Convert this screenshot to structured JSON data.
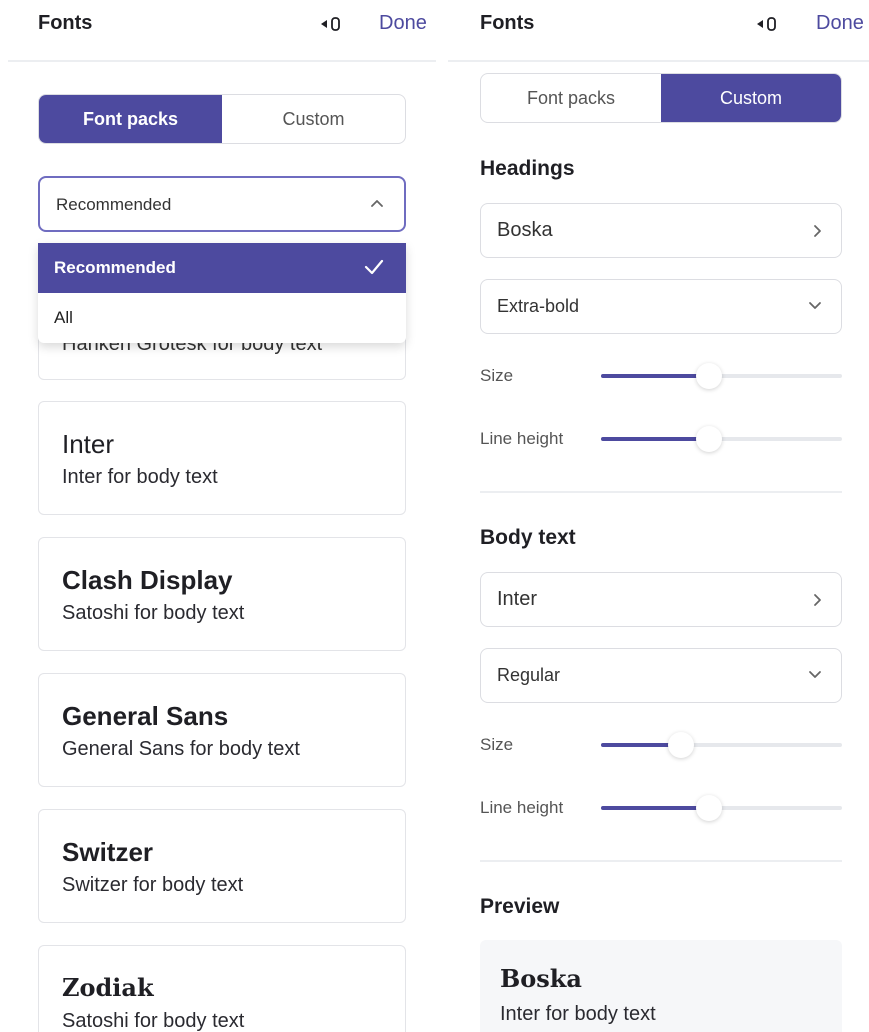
{
  "left_panel": {
    "header": {
      "title": "Fonts",
      "done_label": "Done"
    },
    "tabs": [
      {
        "label": "Font packs",
        "active": true
      },
      {
        "label": "Custom",
        "active": false
      }
    ],
    "filter": {
      "value": "Recommended",
      "options": [
        {
          "label": "Recommended",
          "selected": true
        },
        {
          "label": "All",
          "selected": false
        }
      ]
    },
    "font_packs": [
      {
        "name": "",
        "description": "Hanken Grotesk for body text"
      },
      {
        "name": "Inter",
        "description": "Inter for body text"
      },
      {
        "name": "Clash Display",
        "description": "Satoshi for body text"
      },
      {
        "name": "General Sans",
        "description": "General Sans for body text"
      },
      {
        "name": "Switzer",
        "description": "Switzer for body text"
      },
      {
        "name": "Zodiak",
        "description": "Satoshi for body text"
      }
    ]
  },
  "right_panel": {
    "header": {
      "title": "Fonts",
      "done_label": "Done"
    },
    "tabs": [
      {
        "label": "Font packs",
        "active": false
      },
      {
        "label": "Custom",
        "active": true
      }
    ],
    "headings": {
      "title": "Headings",
      "font": "Boska",
      "weight": "Extra-bold",
      "size_label": "Size",
      "size_value": 0.45,
      "line_height_label": "Line height",
      "line_height_value": 0.45
    },
    "body_text": {
      "title": "Body text",
      "font": "Inter",
      "weight": "Regular",
      "size_label": "Size",
      "size_value": 0.33,
      "line_height_label": "Line height",
      "line_height_value": 0.45
    },
    "preview": {
      "title": "Preview",
      "heading_sample": "Boska",
      "body_sample": "Inter for body text"
    }
  },
  "colors": {
    "accent": "#4d4a9f",
    "border": "#dcdde2",
    "track": "#e6e8ec"
  },
  "icons": [
    "collapse-panel-icon",
    "chevron-up-icon",
    "checkmark-icon",
    "chevron-right-icon",
    "chevron-down-icon"
  ]
}
